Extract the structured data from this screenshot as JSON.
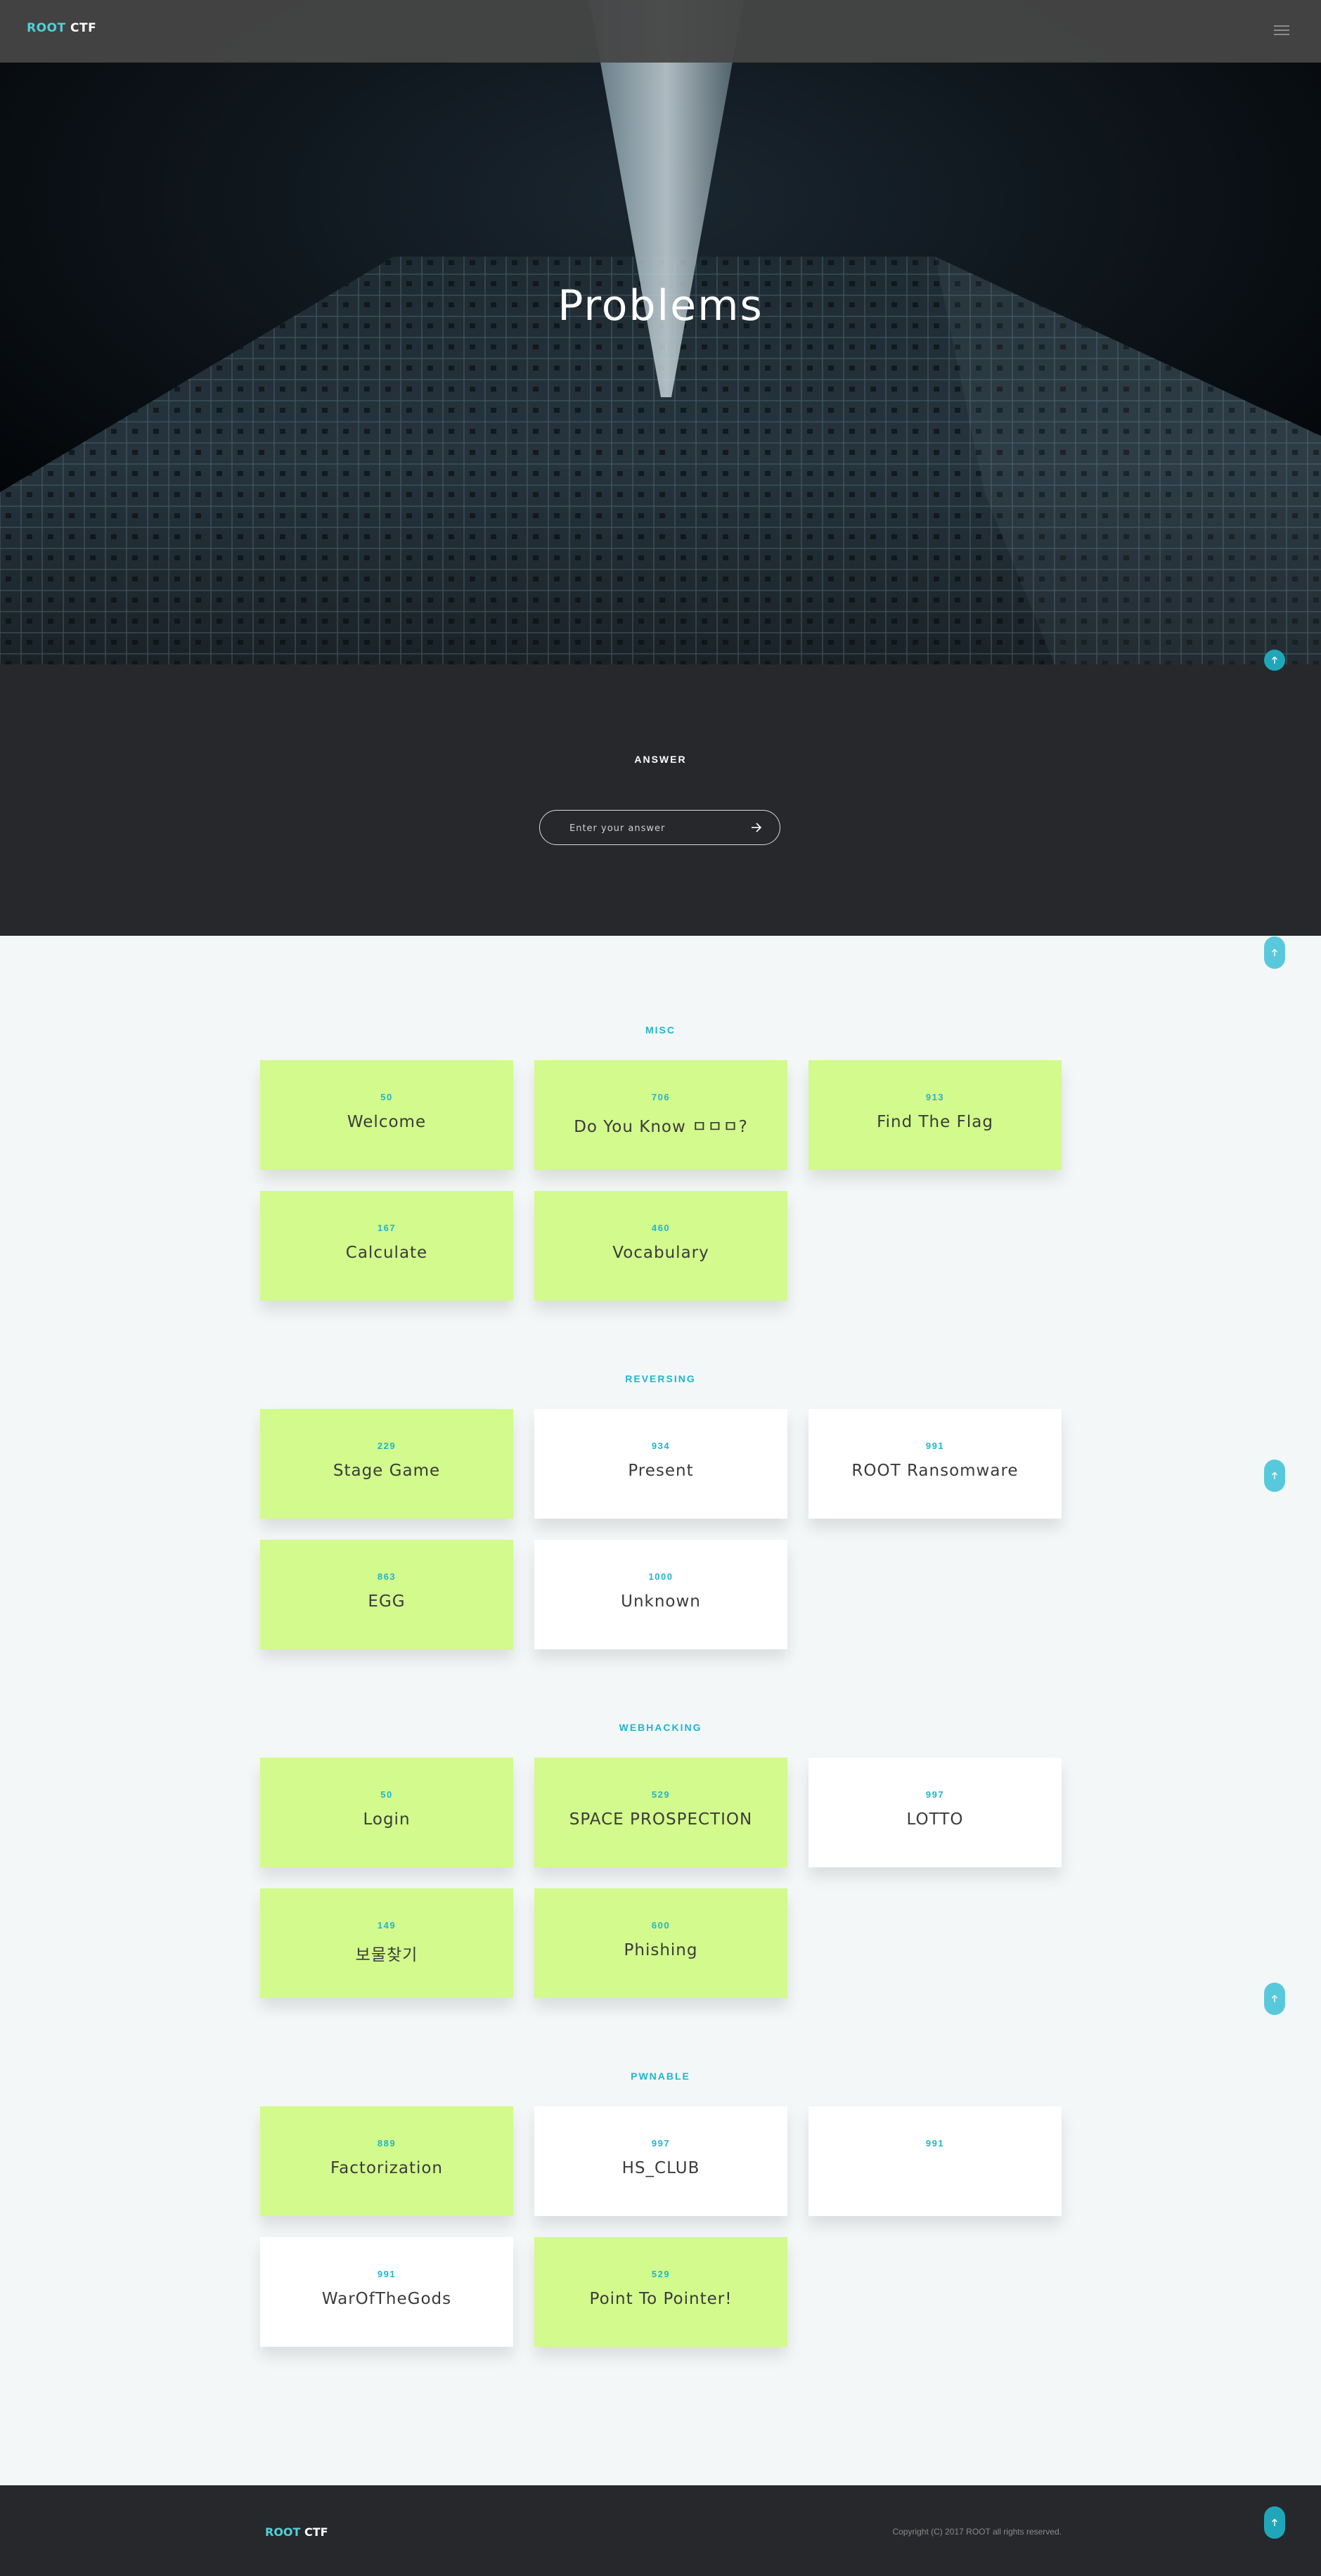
{
  "navbar": {
    "brand_root": "ROOT",
    "brand_ctf": "CTF",
    "menu_icon": "hamburger-menu-icon"
  },
  "hero": {
    "title": "Problems"
  },
  "answer": {
    "label": "ANSWER",
    "placeholder": "Enter your answer",
    "value": "",
    "submit_icon": "arrow-right-icon"
  },
  "categories": [
    {
      "name": "MISC",
      "problems": [
        {
          "points": "50",
          "name": "Welcome",
          "solved": true
        },
        {
          "points": "706",
          "name": "Do You Know ㅁㅁㅁ?",
          "solved": true
        },
        {
          "points": "913",
          "name": "Find The Flag",
          "solved": true
        },
        {
          "points": "167",
          "name": "Calculate",
          "solved": true
        },
        {
          "points": "460",
          "name": "Vocabulary",
          "solved": true
        }
      ]
    },
    {
      "name": "REVERSING",
      "problems": [
        {
          "points": "229",
          "name": "Stage Game",
          "solved": true
        },
        {
          "points": "934",
          "name": "Present",
          "solved": false
        },
        {
          "points": "991",
          "name": "ROOT Ransomware",
          "solved": false
        },
        {
          "points": "863",
          "name": "EGG",
          "solved": true
        },
        {
          "points": "1000",
          "name": "Unknown",
          "solved": false
        }
      ]
    },
    {
      "name": "WEBHACKING",
      "problems": [
        {
          "points": "50",
          "name": "Login",
          "solved": true
        },
        {
          "points": "529",
          "name": "SPACE PROSPECTION",
          "solved": true
        },
        {
          "points": "997",
          "name": "LOTTO",
          "solved": false
        },
        {
          "points": "149",
          "name": "보물찾기",
          "solved": true
        },
        {
          "points": "600",
          "name": "Phishing",
          "solved": true
        }
      ]
    },
    {
      "name": "PWNABLE",
      "problems": [
        {
          "points": "889",
          "name": "Factorization",
          "solved": true
        },
        {
          "points": "997",
          "name": "HS_CLUB",
          "solved": false
        },
        {
          "points": "991",
          "name": "",
          "solved": false
        },
        {
          "points": "991",
          "name": "WarOfTheGods",
          "solved": false
        },
        {
          "points": "529",
          "name": "Point To Pointer!",
          "solved": true
        }
      ]
    }
  ],
  "footer": {
    "brand_root": "ROOT",
    "brand_ctf": "CTF",
    "copyright": "Copyright (C) 2017 ROOT all rights reserved."
  },
  "colors": {
    "accent": "#1fb6cc",
    "solved_card": "#d2fa8c",
    "unsolved_card": "#ffffff",
    "dark_section": "#26282b"
  }
}
